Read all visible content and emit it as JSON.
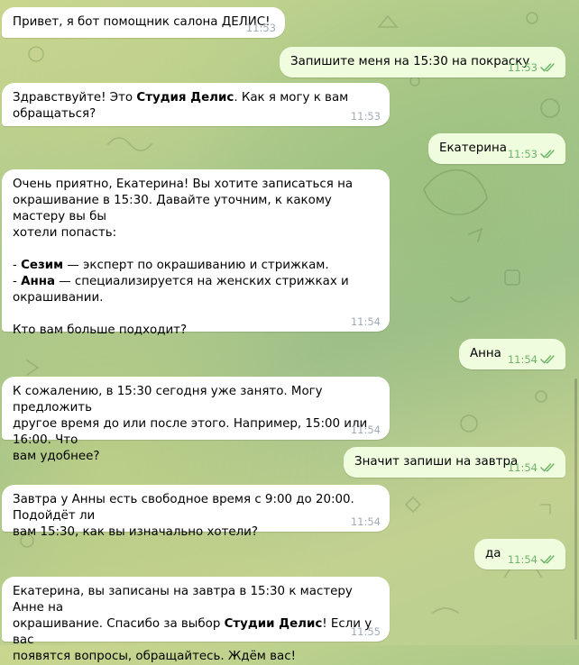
{
  "messages": [
    {
      "dir": "in",
      "parts": [
        {
          "t": "Привет, я бот помощник салона ДЕЛИС!"
        }
      ],
      "time": "11:53"
    },
    {
      "dir": "out",
      "parts": [
        {
          "t": "Запишите меня на 15:30 на покраску"
        }
      ],
      "time": "11:53"
    },
    {
      "dir": "in",
      "parts": [
        {
          "t": "Здравствуйте! Это "
        },
        {
          "t": "Студия Делис",
          "b": true
        },
        {
          "t": ". Как я могу к вам обращаться?"
        }
      ],
      "time": "11:53"
    },
    {
      "dir": "out",
      "parts": [
        {
          "t": "Екатерина"
        }
      ],
      "time": "11:53"
    },
    {
      "dir": "in",
      "parts": [
        {
          "t": "Очень приятно, Екатерина! Вы хотите записаться на\nокрашивание в 15:30. Давайте уточним, к какому мастеру вы бы\nхотели попасть:\n\n- "
        },
        {
          "t": "Сезим",
          "b": true
        },
        {
          "t": " — эксперт по окрашиванию и стрижкам.\n- "
        },
        {
          "t": "Анна",
          "b": true
        },
        {
          "t": " — специализируется на женских стрижках и\nокрашивании.\n\nКто вам больше подходит?"
        }
      ],
      "time": "11:54"
    },
    {
      "dir": "out",
      "parts": [
        {
          "t": "Анна"
        }
      ],
      "time": "11:54"
    },
    {
      "dir": "in",
      "parts": [
        {
          "t": "К сожалению, в 15:30 сегодня уже занято. Могу предложить\nдругое время до или после этого. Например, 15:00 или 16:00. Что\nвам удобнее?"
        }
      ],
      "time": "11:54"
    },
    {
      "dir": "out",
      "parts": [
        {
          "t": "Значит запиши на завтра"
        }
      ],
      "time": "11:54"
    },
    {
      "dir": "in",
      "parts": [
        {
          "t": "Завтра у Анны есть свободное время с 9:00 до 20:00. Подойдёт ли\nвам 15:30, как вы изначально хотели?"
        }
      ],
      "time": "11:54"
    },
    {
      "dir": "out",
      "parts": [
        {
          "t": "да"
        }
      ],
      "time": "11:54"
    },
    {
      "dir": "in",
      "parts": [
        {
          "t": "Екатерина, вы записаны на завтра в 15:30 к мастеру Анне на\nокрашивание. Спасибо за выбор "
        },
        {
          "t": "Студии Делис",
          "b": true
        },
        {
          "t": "! Если у вас\nпоявятся вопросы, обращайтесь. Ждём вас!"
        }
      ],
      "time": "11:55"
    }
  ]
}
